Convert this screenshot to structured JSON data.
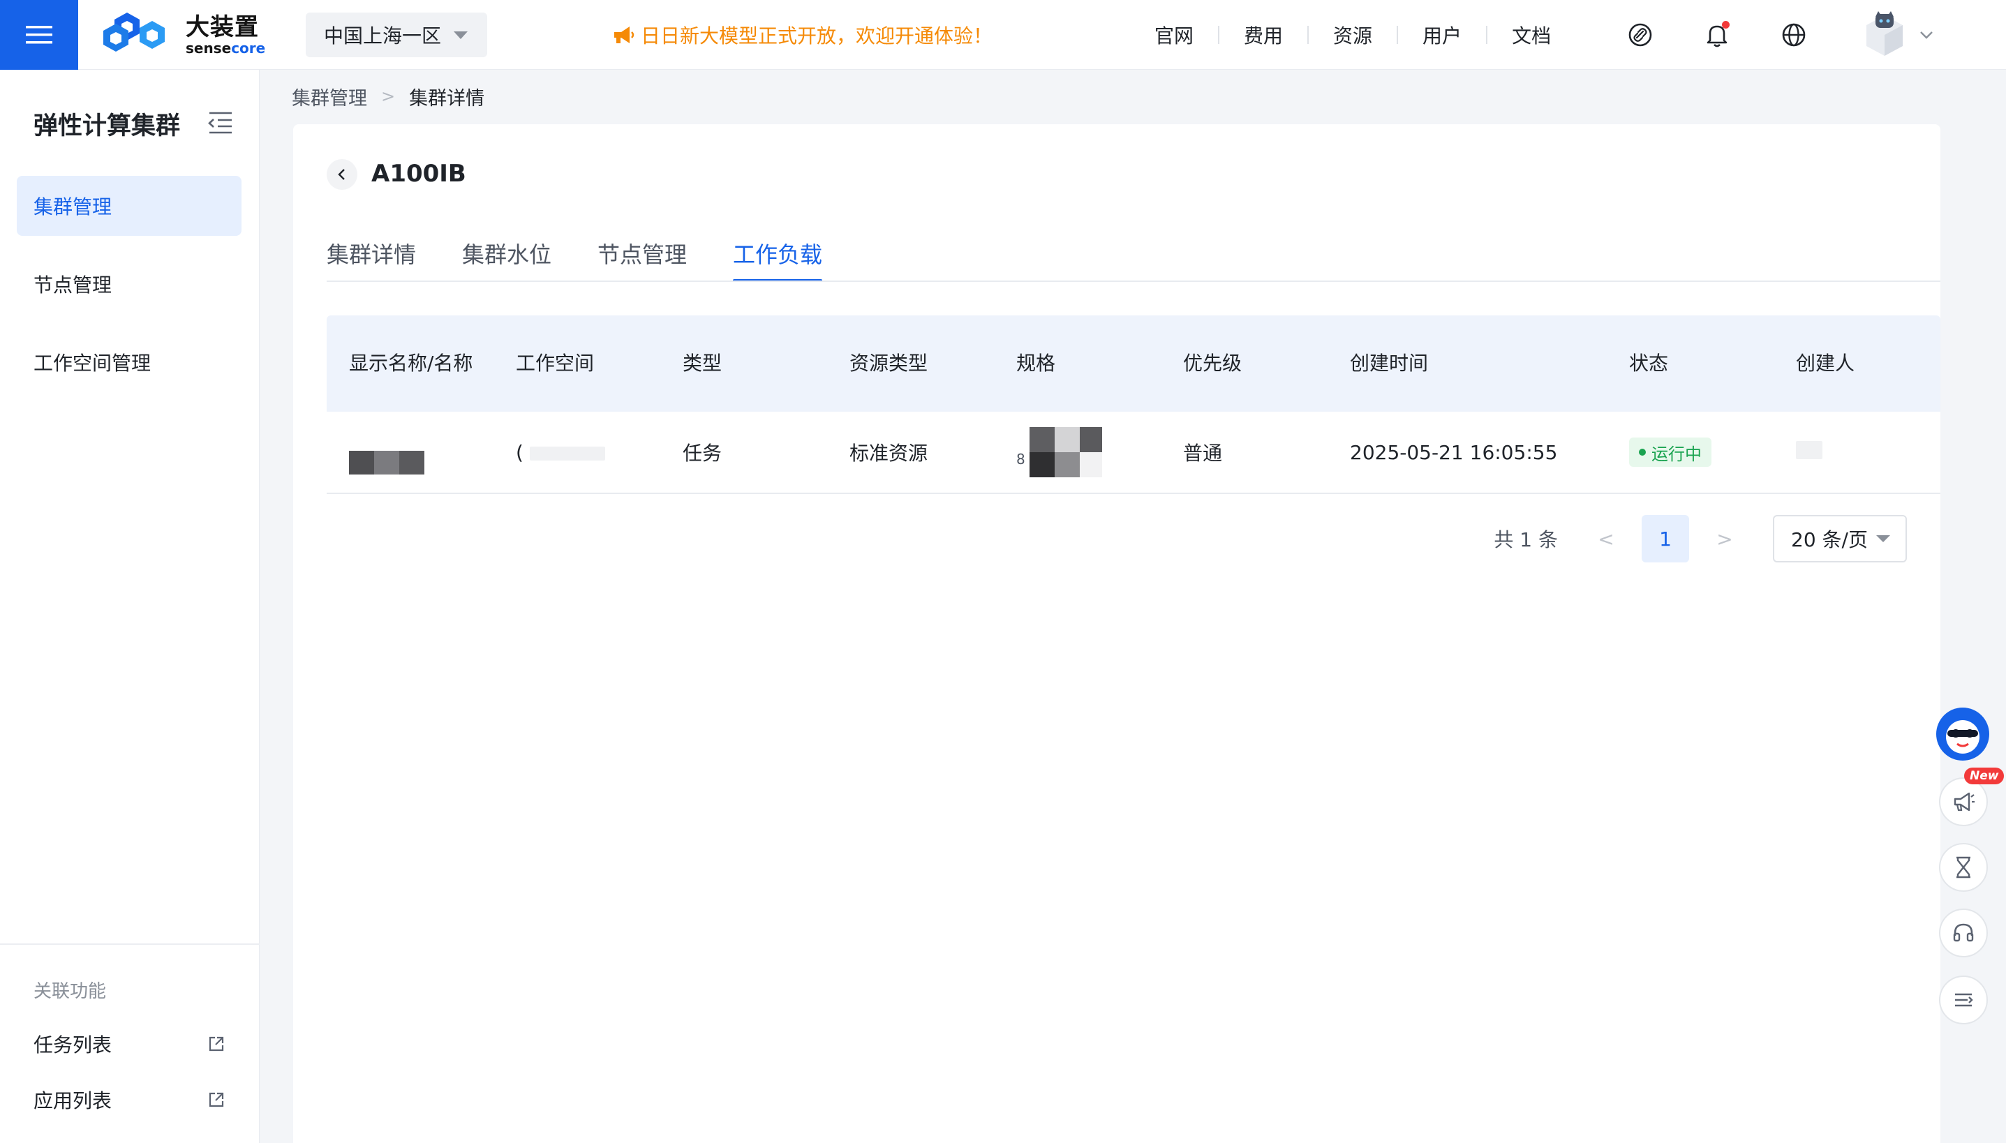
{
  "header": {
    "menu_icon": "hamburger-menu-icon",
    "brand_cn": "大装置",
    "brand_en_a": "sense",
    "brand_en_b": "core",
    "region": "中国上海一区",
    "announcement": "日日新大模型正式开放，欢迎开通体验！",
    "nav": [
      "官网",
      "费用",
      "资源",
      "用户",
      "文档"
    ],
    "icons": [
      "link-circle-icon",
      "bell-icon",
      "globe-icon",
      "user-avatar",
      "chevron-down-icon"
    ]
  },
  "sidebar": {
    "title": "弹性计算集群",
    "items": [
      {
        "label": "集群管理",
        "active": true
      },
      {
        "label": "节点管理",
        "active": false
      },
      {
        "label": "工作空间管理",
        "active": false
      }
    ],
    "section_title": "关联功能",
    "links": [
      {
        "label": "任务列表",
        "icon": "external-link-icon"
      },
      {
        "label": "应用列表",
        "icon": "external-link-icon"
      }
    ]
  },
  "breadcrumb": {
    "items": [
      "集群管理",
      "集群详情"
    ],
    "separator": ">"
  },
  "detail": {
    "title": "A100IB",
    "tabs": [
      {
        "label": "集群详情",
        "active": false
      },
      {
        "label": "集群水位",
        "active": false
      },
      {
        "label": "节点管理",
        "active": false
      },
      {
        "label": "工作负载",
        "active": true
      }
    ]
  },
  "table": {
    "columns": [
      "显示名称/名称",
      "工作空间",
      "类型",
      "资源类型",
      "规格",
      "优先级",
      "创建时间",
      "状态",
      "创建人"
    ],
    "rows": [
      {
        "name": "",
        "workspace": "(",
        "type": "任务",
        "resource_type": "标准资源",
        "spec": "8",
        "priority": "普通",
        "created_at": "2025-05-21 16:05:55",
        "status": "运行中",
        "creator": ""
      }
    ]
  },
  "pagination": {
    "total_text": "共 1 条",
    "prev": "<",
    "current_page": "1",
    "next": ">",
    "page_size": "20 条/页"
  },
  "float_tools": {
    "new_badge": "New",
    "icons": [
      "assistant-avatar-icon",
      "megaphone-icon",
      "hourglass-icon",
      "headset-icon",
      "list-collapse-icon"
    ]
  },
  "colors": {
    "primary": "#1662e8",
    "announcement": "#f58a07",
    "status_running": "#1aa350",
    "notification_dot": "#f23a3a"
  }
}
